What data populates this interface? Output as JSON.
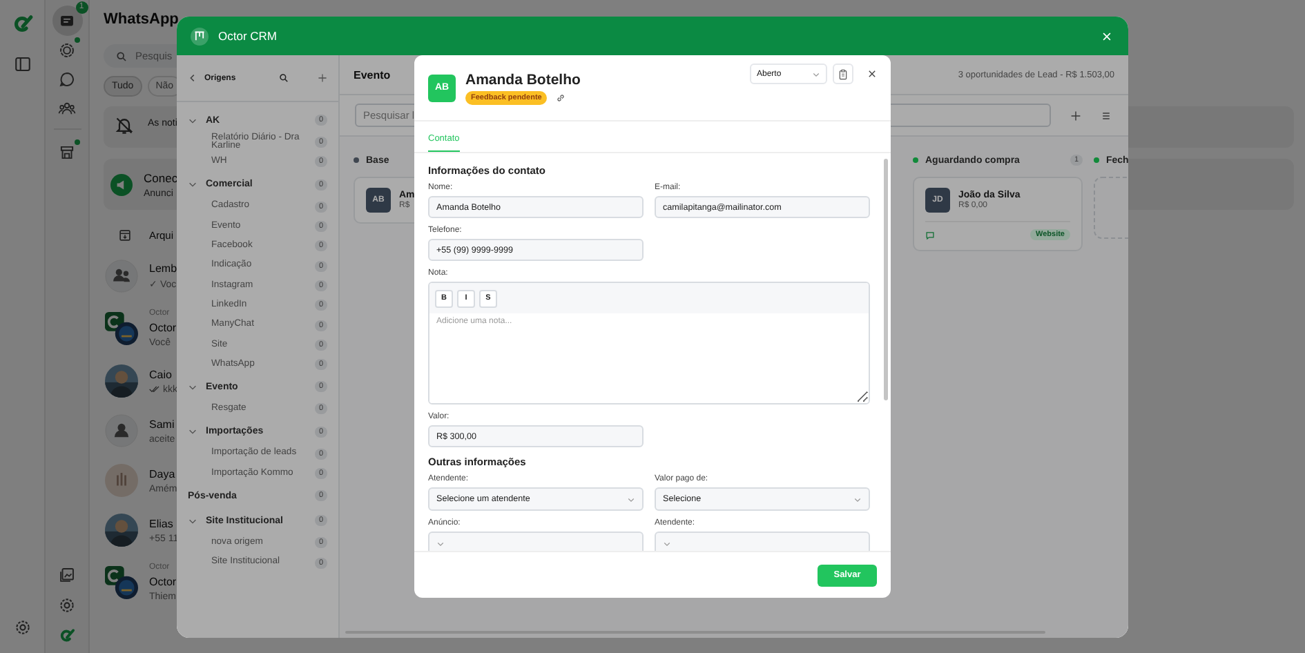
{
  "whatsapp": {
    "rail": [
      {
        "kind": "chats",
        "selected": true,
        "dot": false,
        "badge": "1"
      },
      {
        "kind": "status",
        "selected": false,
        "dot": true
      },
      {
        "kind": "channels",
        "selected": false,
        "dot": false
      },
      {
        "kind": "communities",
        "selected": false,
        "dot": false
      },
      {
        "kind": "store",
        "selected": false,
        "dot": true
      }
    ],
    "title": "WhatsApp",
    "search": {
      "placeholder": "Pesquis"
    },
    "filters": [
      {
        "label": "Tudo",
        "selected": true
      },
      {
        "label": "Não",
        "selected": false
      }
    ],
    "notice": "As noti",
    "promo": {
      "title": "Conec",
      "subtitle": "Anunci"
    },
    "archived": "Arqui",
    "chats": [
      {
        "kind": "group",
        "name": "Lemb",
        "preview": "✓ Voc",
        "read": false
      },
      {
        "kind": "brand",
        "label": "Octor",
        "name": "Octor",
        "preview": "Você",
        "read": false
      },
      {
        "name": "Caio",
        "preview": "kkk",
        "read": true
      },
      {
        "kind": "contact",
        "name": "Sami",
        "preview": "aceite",
        "read": false
      },
      {
        "kind": "tan",
        "name": "Daya",
        "preview": "Amém",
        "read": false
      },
      {
        "name": "Elias",
        "preview": "+55 11",
        "read": false
      },
      {
        "kind": "brand",
        "label": "Octor",
        "name": "Octor",
        "preview": "Thiem",
        "read": false
      }
    ]
  },
  "crm": {
    "title": "Octor CRM",
    "origins": {
      "title": "Origens",
      "groups": [
        {
          "label": "AK",
          "count": "0",
          "expanded": true,
          "children": [
            {
              "label": "Relatório Diário - Dra Karline",
              "count": "0"
            },
            {
              "label": "WH",
              "count": "0"
            }
          ]
        },
        {
          "label": "Comercial",
          "count": "0",
          "expanded": true,
          "children": [
            {
              "label": "Cadastro",
              "count": "0"
            },
            {
              "label": "Evento",
              "count": "0"
            },
            {
              "label": "Facebook",
              "count": "0"
            },
            {
              "label": "Indicação",
              "count": "0"
            },
            {
              "label": "Instagram",
              "count": "0"
            },
            {
              "label": "LinkedIn",
              "count": "0"
            },
            {
              "label": "ManyChat",
              "count": "0"
            },
            {
              "label": "Site",
              "count": "0"
            },
            {
              "label": "WhatsApp",
              "count": "0"
            }
          ]
        },
        {
          "label": "Evento",
          "count": "0",
          "expanded": true,
          "children": [
            {
              "label": "Resgate",
              "count": "0"
            }
          ]
        },
        {
          "label": "Importações",
          "count": "0",
          "expanded": true,
          "children": [
            {
              "label": "Importação de leads",
              "count": "0"
            },
            {
              "label": "Importação Kommo",
              "count": "0"
            }
          ]
        },
        {
          "label": "Pós-venda",
          "count": "0"
        },
        {
          "label": "Site Institucional",
          "count": "0",
          "expanded": true,
          "children": [
            {
              "label": "nova origem",
              "count": "0"
            },
            {
              "label": "Site Institucional",
              "count": "0"
            }
          ]
        }
      ]
    },
    "board": {
      "title": "Evento",
      "summary": "3 oportunidades de Lead - R$ 1.503,00",
      "search": {
        "placeholder": "Pesquisar l"
      },
      "columns": [
        {
          "title": "Base",
          "color": "#3f4650",
          "cards": [
            {
              "initials": "AB",
              "name": "Am",
              "value": "R$"
            }
          ]
        },
        {
          "title": "Aguardando compra",
          "color": "#118a3a",
          "count": "1",
          "cards": [
            {
              "initials": "JD",
              "name": "João da Silva",
              "value": "R$ 0,00",
              "tag": "Website"
            }
          ]
        },
        {
          "title": "Fech",
          "color": "#118a3a",
          "empty": true
        }
      ]
    }
  },
  "modal": {
    "initials": "AB",
    "name": "Amanda Botelho",
    "badge": "Feedback pendente",
    "status": "Aberto",
    "tabs": [
      {
        "label": "Contato",
        "selected": true
      }
    ],
    "sections": [
      {
        "title": "Informações do contato",
        "rows": [
          [
            {
              "kind": "input",
              "label": "Nome:",
              "value": "Amanda Botelho"
            },
            {
              "kind": "input",
              "label": "E-mail:",
              "value": "camilapitanga@mailinator.com"
            }
          ],
          [
            {
              "kind": "input",
              "label": "Telefone:",
              "value": "+55 (99) 9999-9999"
            }
          ],
          [
            {
              "kind": "editor",
              "label": "Nota:",
              "tools": [
                "B",
                "I",
                "S"
              ],
              "placeholder": "Adicione uma nota..."
            }
          ],
          [
            {
              "kind": "input",
              "label": "Valor:",
              "value": "R$ 300,00"
            }
          ]
        ]
      },
      {
        "title": "Outras informações",
        "rows": [
          [
            {
              "kind": "select",
              "label": "Atendente:",
              "value": "Selecione um atendente"
            },
            {
              "kind": "select",
              "label": "Valor pago de:",
              "value": "Selecione"
            }
          ],
          [
            {
              "kind": "select",
              "label": "Anúncio:"
            },
            {
              "kind": "select",
              "label": "Atendente:"
            }
          ]
        ]
      }
    ],
    "save": "Salvar"
  }
}
